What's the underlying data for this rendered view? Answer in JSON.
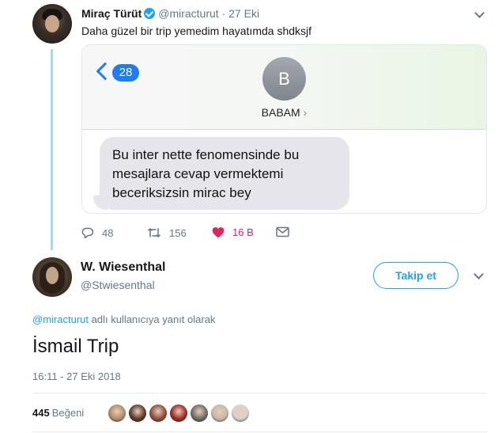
{
  "tweet1": {
    "name": "Miraç Türüt",
    "handle": "@miracturut",
    "separator": "·",
    "date": "27 Eki",
    "text": "Daha güzel bir trip yemedim hayatımda shdksjf",
    "media": {
      "back_count": "28",
      "contact_initial": "B",
      "contact_name": "BABAM",
      "contact_chevron": "›",
      "message_lines": [
        "Bu inter nette fenomensinde bu",
        "mesajlara cevap vermektemi",
        "beceriksizsin mirac bey"
      ]
    },
    "actions": {
      "replies": "48",
      "retweets": "156",
      "likes": "16 B"
    }
  },
  "tweet2": {
    "name": "W. Wiesenthal",
    "handle": "@Stwiesenthal",
    "follow_label": "Takip et",
    "reply_mention": "@miracturut",
    "reply_suffix": "adlı kullanıcıya yanıt olarak",
    "text": "İsmail Trip",
    "timestamp": "16:11 - 27 Eki 2018",
    "like_count": "445",
    "like_label": "Beğeni",
    "liker_colors": [
      "#b08b6a",
      "#5a3a2c",
      "#8c4c3c",
      "#9a2a24",
      "#6d6a66",
      "#c9b7a6",
      "#d8d2cc"
    ]
  },
  "colors": {
    "link": "#1da1f2",
    "like": "#e0245e",
    "muted": "#657786",
    "imessage_blue": "#1e7cf5",
    "bubble_gray": "#e6e5eb"
  }
}
